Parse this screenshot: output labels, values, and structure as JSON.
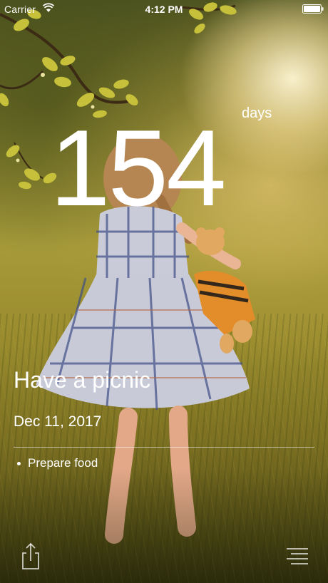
{
  "status_bar": {
    "carrier": "Carrier",
    "time": "4:12 PM",
    "wifi_icon": "wifi-icon",
    "battery_icon": "battery-full-icon"
  },
  "countdown": {
    "value": "154",
    "unit": "days"
  },
  "event": {
    "title": "Have a picnic",
    "date": "Dec 11, 2017"
  },
  "tasks": [
    {
      "label": "Prepare food"
    }
  ],
  "toolbar": {
    "share_icon": "share-icon",
    "menu_icon": "list-menu-icon"
  },
  "background": {
    "description_icon": "photo-background",
    "accent": "#9a8c2e"
  }
}
